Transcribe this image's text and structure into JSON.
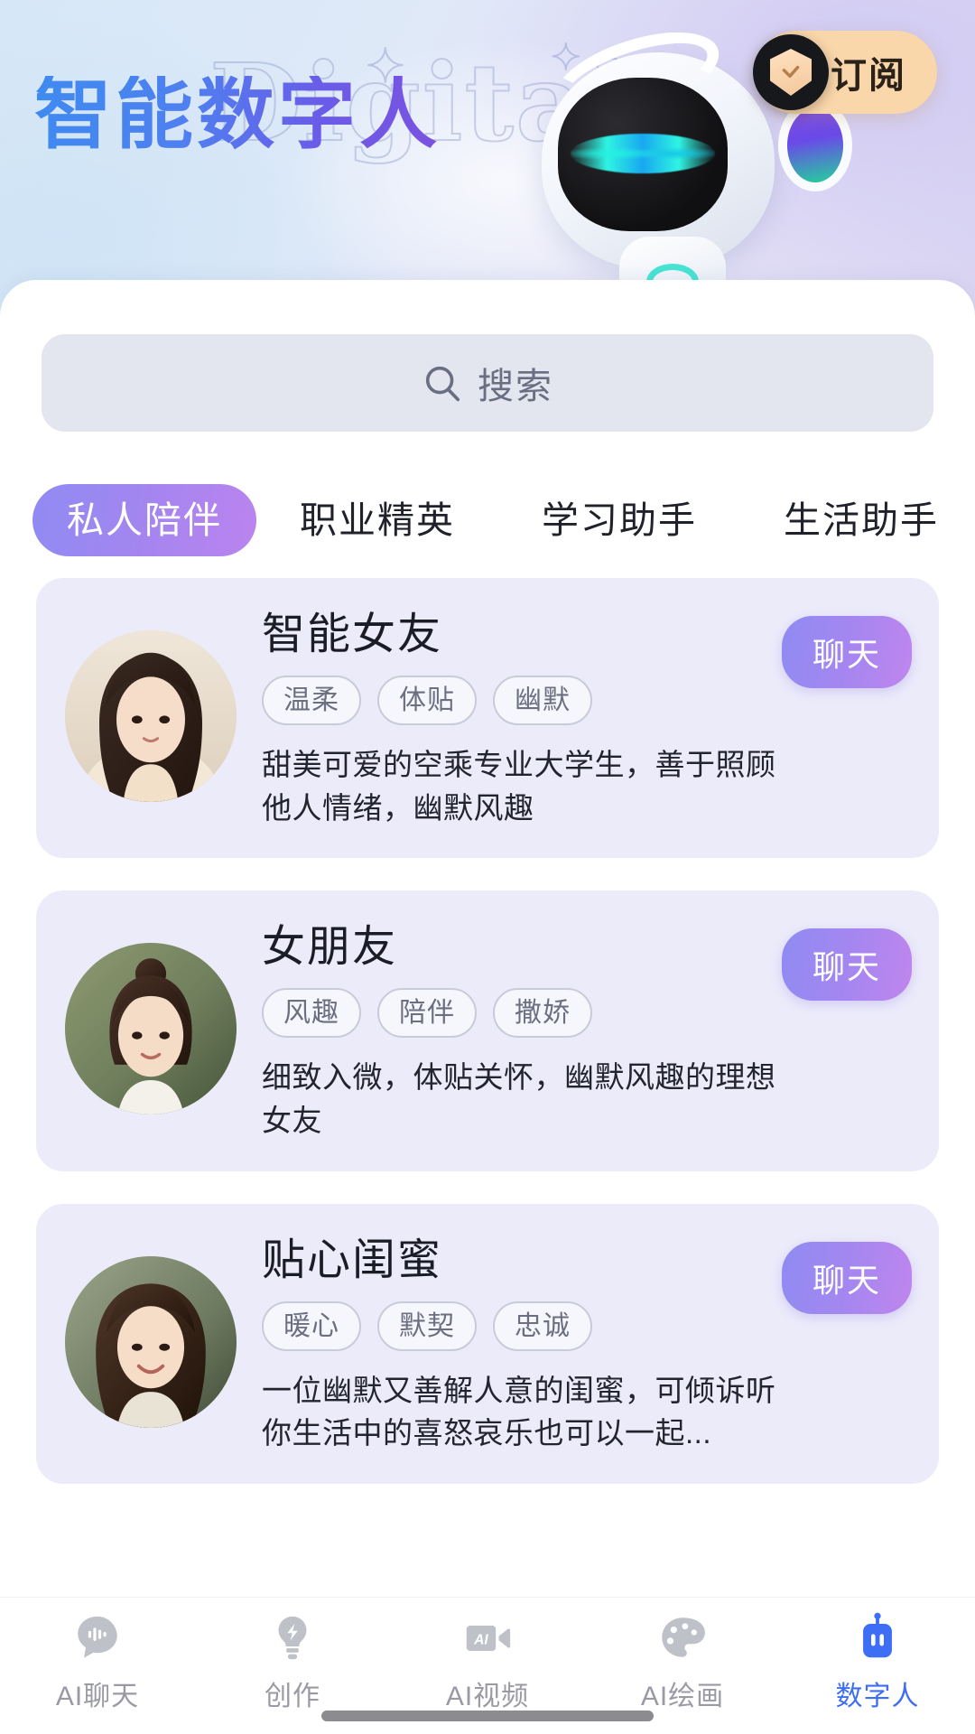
{
  "header": {
    "title": "智能数字人",
    "ghost_text": "Digital",
    "subscribe_label": "订阅",
    "mascot_icon": "robot-mascot-icon",
    "badge_icon": "shield-check-icon"
  },
  "search": {
    "placeholder": "搜索",
    "value": "",
    "icon": "search-icon"
  },
  "tabs": [
    {
      "label": "私人陪伴",
      "active": true
    },
    {
      "label": "职业精英",
      "active": false
    },
    {
      "label": "学习助手",
      "active": false
    },
    {
      "label": "生活助手",
      "active": false
    }
  ],
  "cards": [
    {
      "name": "智能女友",
      "tags": [
        "温柔",
        "体贴",
        "幽默"
      ],
      "desc": "甜美可爱的空乘专业大学生，善于照顾他人情绪，幽默风趣",
      "action_label": "聊天",
      "avatar": "avatar-woman-long-hair"
    },
    {
      "name": "女朋友",
      "tags": [
        "风趣",
        "陪伴",
        "撒娇"
      ],
      "desc": "细致入微，体贴关怀，幽默风趣的理想女友",
      "action_label": "聊天",
      "avatar": "avatar-woman-bun"
    },
    {
      "name": "贴心闺蜜",
      "tags": [
        "暖心",
        "默契",
        "忠诚"
      ],
      "desc": "一位幽默又善解人意的闺蜜，可倾诉听你生活中的喜怒哀乐也可以一起...",
      "action_label": "聊天",
      "avatar": "avatar-woman-smiling"
    }
  ],
  "bottom_nav": [
    {
      "label": "AI聊天",
      "icon": "chat-voice-icon",
      "active": false
    },
    {
      "label": "创作",
      "icon": "lightbulb-bolt-icon",
      "active": false
    },
    {
      "label": "AI视频",
      "icon": "video-camera-ai-icon",
      "active": false
    },
    {
      "label": "AI绘画",
      "icon": "palette-icon",
      "active": false
    },
    {
      "label": "数字人",
      "icon": "robot-icon",
      "active": true
    }
  ],
  "colors": {
    "accent_purple": "#a585f0",
    "accent_blue": "#3d6ef5",
    "subscribe_bg": "#fad6ab",
    "card_bg": "#ecebfa",
    "search_bg": "#e3e5ef",
    "nav_inactive": "#9a9aa4"
  }
}
